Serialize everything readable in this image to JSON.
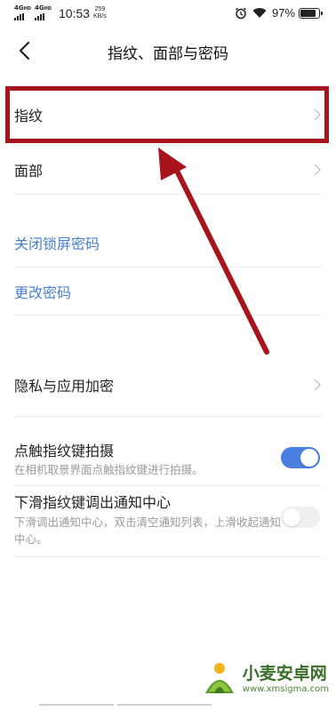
{
  "status_bar": {
    "net1": "4G",
    "net1_sup": "HD",
    "net2": "4G",
    "net2_sup": "HD",
    "time": "10:53",
    "speed_value": "259",
    "speed_unit": "KB/s",
    "battery_text": "97%",
    "battery_level": 0.97
  },
  "header": {
    "title": "指纹、面部与密码"
  },
  "items": {
    "fingerprint": "指纹",
    "face": "面部",
    "close_lock_password": "关闭锁屏密码",
    "change_password": "更改密码",
    "privacy_encryption": "隐私与应用加密",
    "touch_shoot_title": "点触指纹键拍摄",
    "touch_shoot_desc": "在相机取景界面点触指纹键进行拍摄。",
    "touch_shoot_enabled": true,
    "swipe_notify_title": "下滑指纹键调出通知中心",
    "swipe_notify_desc": "下滑调出通知中心，双击清空通知列表，上滑收起通知中心。",
    "swipe_notify_enabled": false
  },
  "colors": {
    "link_blue": "#4a7fd0",
    "toggle_on": "#4a7ee0",
    "annotation_red": "#a8141c"
  },
  "watermark": {
    "title": "小麦安卓网",
    "url": "www.xmsigma.com"
  }
}
